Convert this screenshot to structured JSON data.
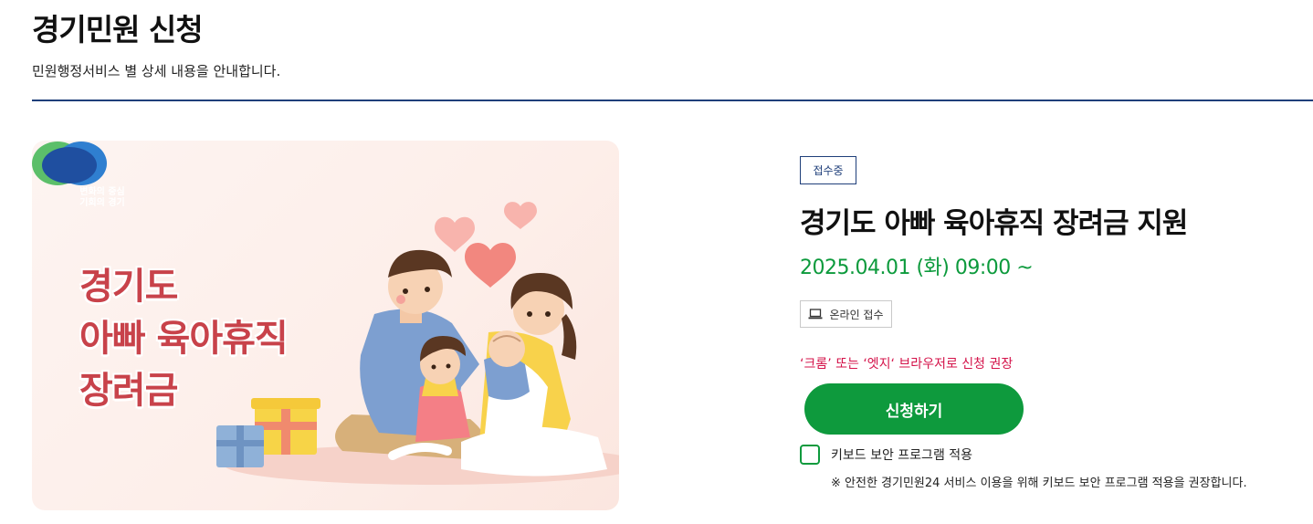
{
  "header": {
    "title": "경기민원 신청",
    "description": "민원행정서비스 별 상세 내용을 안내합니다."
  },
  "banner": {
    "logo_text": [
      "변화의 중심",
      "기회의 경기"
    ],
    "title_lines": [
      "경기도",
      "아빠 육아휴직",
      "장려금"
    ]
  },
  "service": {
    "status": "접수중",
    "title": "경기도 아빠 육아휴직 장려금 지원",
    "date": "2025.04.01 (화) 09:00 ~",
    "channel": {
      "icon": "laptop-icon",
      "label": "온라인 접수"
    },
    "browser_note": "‘크롬’ 또는 ‘엣지‘ 브라우저로 신청 권장",
    "apply_label": "신청하기",
    "keyboard_security": {
      "label": "키보드 보안 프로그램 적용",
      "checked": false,
      "note": "※ 안전한 경기민원24 서비스 이용을 위해 키보드 보안 프로그램 적용을 권장합니다."
    }
  },
  "colors": {
    "accent_green": "#0e9a3d",
    "navy": "#1f3f7a",
    "warning_red": "#d4134a",
    "banner_title": "#c8424a"
  }
}
